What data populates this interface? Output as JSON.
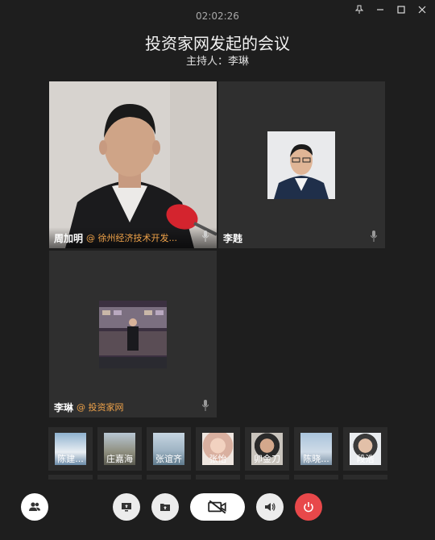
{
  "timer": "02:02:26",
  "meeting": {
    "title": "投资家网发起的会议",
    "host_label": "主持人：李琳"
  },
  "participants_main": [
    {
      "name": "周加明",
      "org": "@ 徐州经济技术开发..."
    },
    {
      "name": "李韪",
      "org": ""
    },
    {
      "name": "李琳",
      "org": "@ 投资家网"
    }
  ],
  "participants_strip": [
    "陈建...",
    "庄嘉海",
    "张谊齐",
    "张怡",
    "卯金刀",
    "陈晓...",
    "段浩"
  ],
  "icons": {
    "pin": "pin-icon",
    "minimize": "minimize-icon",
    "maximize": "maximize-icon",
    "close": "close-icon",
    "mic": "microphone-icon",
    "participants": "participants-icon",
    "share_screen": "share-screen-icon",
    "share_file": "share-file-icon",
    "camera_off": "camera-off-icon",
    "speaker": "speaker-icon",
    "power": "power-icon"
  },
  "colors": {
    "org_text": "#f0a34a",
    "end_button": "#e8484a",
    "control_button": "#ececec"
  }
}
